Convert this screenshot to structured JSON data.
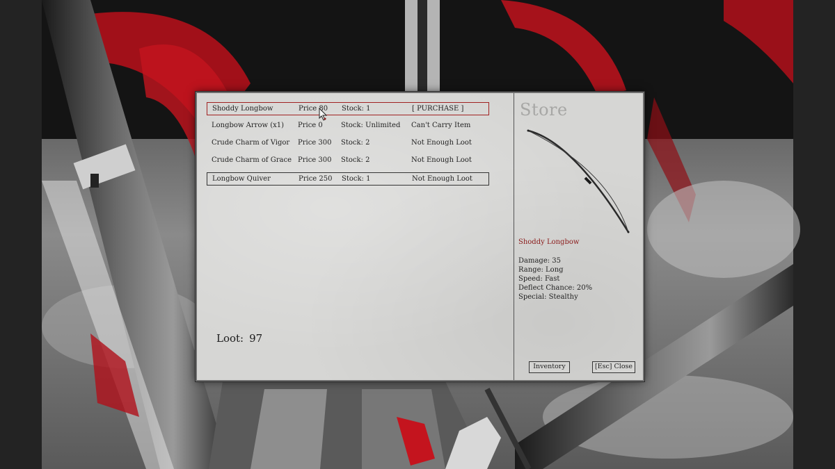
{
  "store": {
    "title": "Store",
    "items": [
      {
        "name": "Shoddy Longbow",
        "price": "Price 80",
        "stock": "Stock: 1",
        "status": "[ PURCHASE ]"
      },
      {
        "name": "Longbow Arrow (x1)",
        "price": "Price 0",
        "stock": "Stock: Unlimited",
        "status": "Can't Carry Item"
      },
      {
        "name": "Crude Charm of Vigor",
        "price": "Price 300",
        "stock": "Stock: 2",
        "status": "Not Enough Loot"
      },
      {
        "name": "Crude Charm of Grace",
        "price": "Price 300",
        "stock": "Stock: 2",
        "status": "Not Enough Loot"
      },
      {
        "name": "Longbow Quiver",
        "price": "Price 250",
        "stock": "Stock: 1",
        "status": "Not Enough Loot"
      }
    ],
    "loot_label": "Loot:",
    "loot_value": "97"
  },
  "detail": {
    "item_name": "Shoddy Longbow",
    "item_icon": "longbow-icon",
    "stats": {
      "damage": "Damage: 35",
      "range": "Range: Long",
      "speed": "Speed: Fast",
      "deflect": "Deflect Chance: 20%",
      "special": "Special: Stealthy"
    }
  },
  "buttons": {
    "inventory": "Inventory",
    "close": "[Esc] Close"
  },
  "colors": {
    "accent_red": "#a02020",
    "item_name_red": "#8a1a1a",
    "panel_bg": "#d6d6d4"
  }
}
